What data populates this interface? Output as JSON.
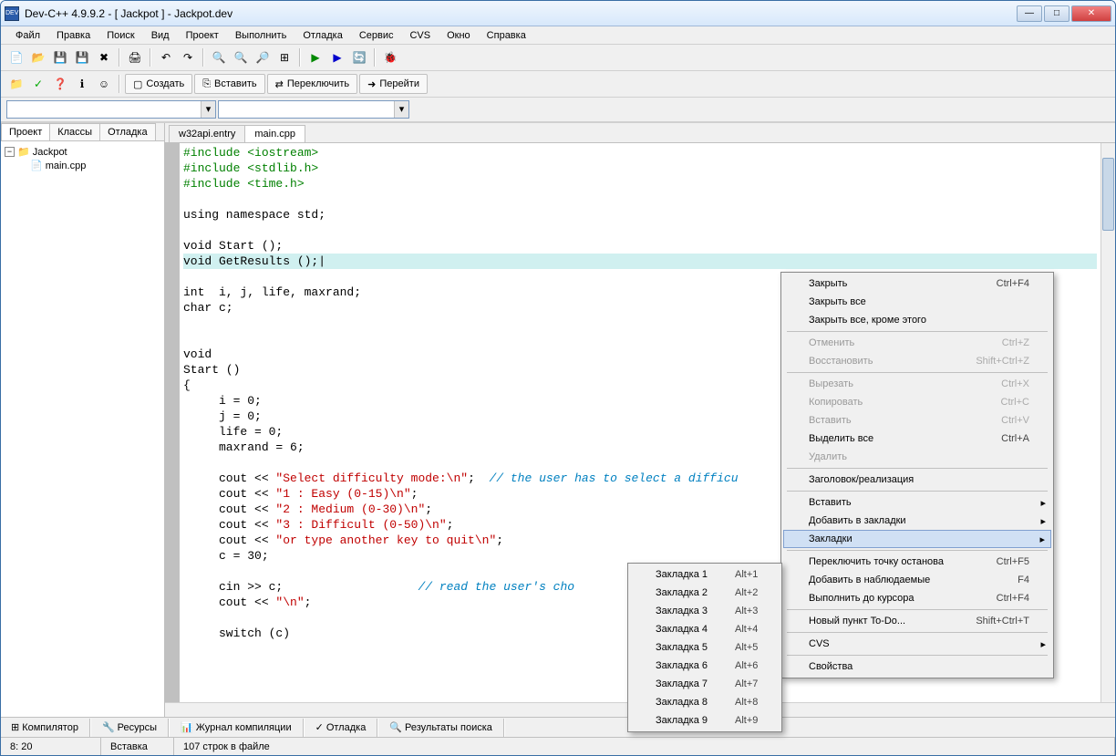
{
  "window": {
    "title": "Dev-C++ 4.9.9.2  -  [ Jackpot ] - Jackpot.dev",
    "icon_label": "DEV"
  },
  "menus": [
    "Файл",
    "Правка",
    "Поиск",
    "Вид",
    "Проект",
    "Выполнить",
    "Отладка",
    "Сервис",
    "CVS",
    "Окно",
    "Справка"
  ],
  "toolbar2": {
    "create": "Создать",
    "insert": "Вставить",
    "toggle": "Переключить",
    "go": "Перейти"
  },
  "left_tabs": [
    "Проект",
    "Классы",
    "Отладка"
  ],
  "tree": {
    "root": "Jackpot",
    "child": "main.cpp"
  },
  "editor_tabs": [
    "w32api.entry",
    "main.cpp"
  ],
  "code": {
    "l1a": "#include ",
    "l1b": "<iostream>",
    "l2a": "#include ",
    "l2b": "<stdlib.h>",
    "l3a": "#include ",
    "l3b": "<time.h>",
    "l5": "using namespace std;",
    "l7": "void Start ();",
    "l8": "void GetResults ();",
    "l10": "int  i, j, life, maxrand;",
    "l11": "char c;",
    "l14": "void",
    "l15": "Start ()",
    "l16": "{",
    "l17": "     i = 0;",
    "l18": "     j = 0;",
    "l19": "     life = 0;",
    "l20": "     maxrand = 6;",
    "l22a": "     cout << ",
    "l22b": "\"Select difficulty mode:\\n\"",
    "l22c": ";  ",
    "l22d": "// the user has to select a difficu",
    "l23a": "     cout << ",
    "l23b": "\"1 : Easy (0-15)\\n\"",
    "l23c": ";",
    "l24a": "     cout << ",
    "l24b": "\"2 : Medium (0-30)\\n\"",
    "l24c": ";",
    "l25a": "     cout << ",
    "l25b": "\"3 : Difficult (0-50)\\n\"",
    "l25c": ";",
    "l26a": "     cout << ",
    "l26b": "\"or type another key to quit\\n\"",
    "l26c": ";",
    "l27": "     c = 30;",
    "l29": "     cin >> c;                   ",
    "l29b": "// read the user's cho",
    "l30a": "     cout << ",
    "l30b": "\"\\n\"",
    "l30c": ";",
    "l32": "     switch (c)"
  },
  "bottom_tabs": [
    {
      "icon": "⊞",
      "label": "Компилятор"
    },
    {
      "icon": "🔧",
      "label": "Ресурсы"
    },
    {
      "icon": "📊",
      "label": "Журнал компиляции"
    },
    {
      "icon": "✓",
      "label": "Отладка"
    },
    {
      "icon": "🔍",
      "label": "Результаты поиска"
    }
  ],
  "status": {
    "pos": "8: 20",
    "mode": "Вставка",
    "lines": "107 строк в файле"
  },
  "context_main": [
    {
      "label": "Закрыть",
      "shortcut": "Ctrl+F4"
    },
    {
      "label": "Закрыть все"
    },
    {
      "label": "Закрыть все, кроме этого"
    },
    {
      "sep": true
    },
    {
      "label": "Отменить",
      "shortcut": "Ctrl+Z",
      "disabled": true
    },
    {
      "label": "Восстановить",
      "shortcut": "Shift+Ctrl+Z",
      "disabled": true
    },
    {
      "sep": true
    },
    {
      "label": "Вырезать",
      "shortcut": "Ctrl+X",
      "disabled": true
    },
    {
      "label": "Копировать",
      "shortcut": "Ctrl+C",
      "disabled": true
    },
    {
      "label": "Вставить",
      "shortcut": "Ctrl+V",
      "disabled": true
    },
    {
      "label": "Выделить все",
      "shortcut": "Ctrl+A"
    },
    {
      "label": "Удалить",
      "disabled": true
    },
    {
      "sep": true
    },
    {
      "label": "Заголовок/реализация"
    },
    {
      "sep": true
    },
    {
      "label": "Вставить",
      "sub": true
    },
    {
      "label": "Добавить в закладки",
      "sub": true
    },
    {
      "label": "Закладки",
      "sub": true,
      "highlight": true
    },
    {
      "sep": true
    },
    {
      "label": "Переключить точку останова",
      "shortcut": "Ctrl+F5"
    },
    {
      "label": "Добавить в наблюдаемые",
      "shortcut": "F4"
    },
    {
      "label": "Выполнить до курсора",
      "shortcut": "Ctrl+F4"
    },
    {
      "sep": true
    },
    {
      "label": "Новый пункт To-Do...",
      "shortcut": "Shift+Ctrl+T"
    },
    {
      "sep": true
    },
    {
      "label": "CVS",
      "sub": true
    },
    {
      "sep": true
    },
    {
      "label": "Свойства"
    }
  ],
  "context_sub": [
    {
      "label": "Закладка 1",
      "shortcut": "Alt+1"
    },
    {
      "label": "Закладка 2",
      "shortcut": "Alt+2"
    },
    {
      "label": "Закладка 3",
      "shortcut": "Alt+3"
    },
    {
      "label": "Закладка 4",
      "shortcut": "Alt+4"
    },
    {
      "label": "Закладка 5",
      "shortcut": "Alt+5"
    },
    {
      "label": "Закладка 6",
      "shortcut": "Alt+6"
    },
    {
      "label": "Закладка 7",
      "shortcut": "Alt+7"
    },
    {
      "label": "Закладка 8",
      "shortcut": "Alt+8"
    },
    {
      "label": "Закладка 9",
      "shortcut": "Alt+9"
    }
  ]
}
